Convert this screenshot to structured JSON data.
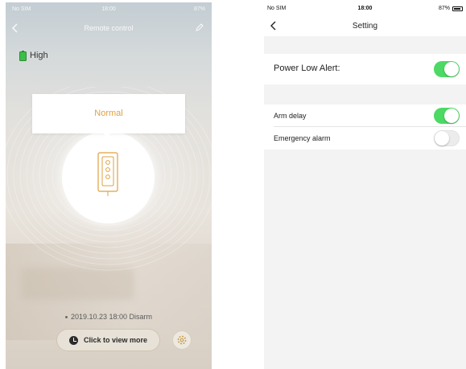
{
  "left_screen": {
    "status_bar": {
      "carrier": "No SIM",
      "time": "18:00",
      "right": "87%"
    },
    "nav": {
      "title": "Remote control"
    },
    "battery": {
      "label": "High"
    },
    "status_popup": {
      "text": "Normal"
    },
    "event": {
      "text": "2019.10.23 18:00 Disarm"
    },
    "view_more_button": {
      "label": "Click to view more"
    },
    "icons": [
      "back-arrow-icon",
      "edit-icon",
      "battery-icon",
      "remote-device-icon",
      "clock-icon",
      "settings-icon"
    ]
  },
  "right_screen": {
    "status_bar": {
      "carrier": "No SIM",
      "time": "18:00",
      "battery": "87%"
    },
    "nav": {
      "title": "Setting"
    },
    "settings": [
      {
        "label": "Power Low Alert:",
        "enabled": true
      },
      {
        "label": "Arm delay",
        "enabled": true
      },
      {
        "label": "Emergency alarm",
        "enabled": false
      }
    ]
  },
  "colors": {
    "toggle_on": "#4cd964",
    "accent_orange": "#e0a040",
    "battery_green": "#3cbf4a"
  }
}
